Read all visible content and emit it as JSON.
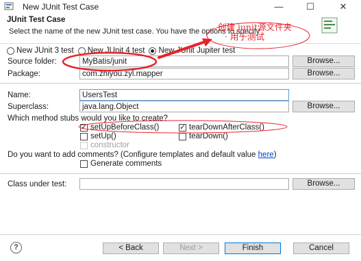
{
  "window": {
    "title": "New JUnit Test Case",
    "minimize_glyph": "—",
    "maximize_glyph": "☐",
    "close_glyph": "✕"
  },
  "header": {
    "title": "JUnit Test Case",
    "description": "Select the name of the new JUnit test case. You have the options to specify"
  },
  "junit_version": {
    "options": [
      "New JUnit 3 test",
      "New JUnit 4 test",
      "New JUnit Jupiter test"
    ],
    "selected": "New JUnit Jupiter test"
  },
  "source_folder": {
    "label": "Source folder:",
    "value": "MyBatis/junit",
    "browse_label": "Browse..."
  },
  "package": {
    "label": "Package:",
    "value": "com.zhiyou.zyl.mapper",
    "browse_label": "Browse..."
  },
  "name": {
    "label": "Name:",
    "value": "UsersTest"
  },
  "superclass": {
    "label": "Superclass:",
    "value": "java.lang.Object",
    "browse_label": "Browse..."
  },
  "stubs": {
    "question": "Which method stubs would you like to create?",
    "setUpBeforeClass": {
      "label": "setUpBeforeClass()",
      "checked": true
    },
    "tearDownAfterClass": {
      "label": "tearDownAfterClass()",
      "checked": true
    },
    "setUp": {
      "label": "setUp()",
      "checked": false
    },
    "tearDown": {
      "label": "tearDown()",
      "checked": false
    },
    "constructor": {
      "label": "constructor",
      "checked": false,
      "enabled": false
    }
  },
  "comments": {
    "question": "Do you want to add comments? (Configure templates and default value ",
    "link": "here",
    "question_end": ")",
    "generate": {
      "label": "Generate comments",
      "checked": false
    }
  },
  "class_under_test": {
    "label": "Class under test:",
    "value": "",
    "browse_label": "Browse..."
  },
  "footer": {
    "help_glyph": "?",
    "back_label": "< Back",
    "next_label": "Next >",
    "finish_label": "Finish",
    "cancel_label": "Cancel"
  },
  "annotation": {
    "line1": "创建 junit源文件夹",
    "line2": "· 用于测试",
    "color": "#e8222a"
  }
}
